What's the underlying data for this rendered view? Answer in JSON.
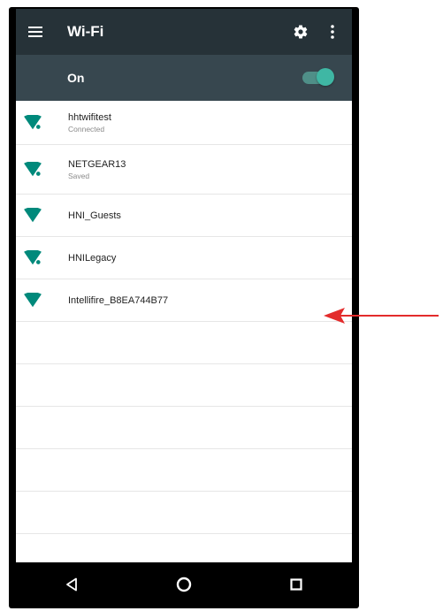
{
  "toolbar": {
    "title": "Wi-Fi",
    "icons": [
      "menu-icon",
      "gear-icon",
      "more-vert-icon"
    ]
  },
  "switchbar": {
    "label": "On",
    "toggle_state": "on"
  },
  "networks": [
    {
      "ssid": "hhtwifitest",
      "status": "Connected",
      "secured": true
    },
    {
      "ssid": "NETGEAR13",
      "status": "Saved",
      "secured": true
    },
    {
      "ssid": "HNI_Guests",
      "status": "",
      "secured": false
    },
    {
      "ssid": "HNILegacy",
      "status": "",
      "secured": true
    },
    {
      "ssid": "Intellifire_B8EA744B77",
      "status": "",
      "secured": false
    }
  ],
  "navbar": {
    "icons": [
      "back-icon",
      "home-icon",
      "recents-icon"
    ]
  },
  "colors": {
    "toolbar_bg": "#263238",
    "switchbar_bg": "#37474f",
    "accent": "#00897b",
    "annotation_arrow": "#e32b2b"
  }
}
